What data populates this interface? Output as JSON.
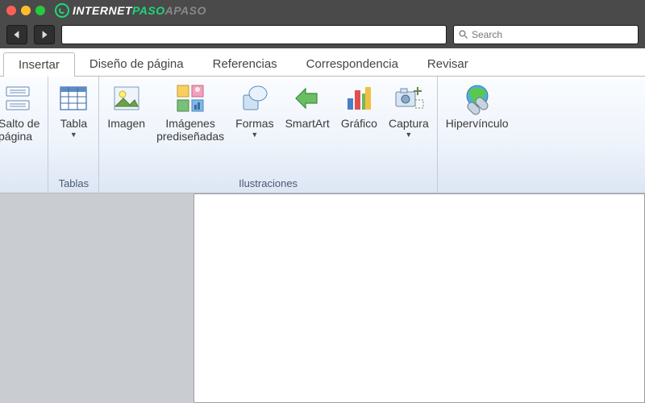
{
  "browser": {
    "logo": {
      "part1": "INTERNET",
      "part2": "PASO",
      "part3": "APASO"
    },
    "search_placeholder": "Search"
  },
  "ribbon": {
    "tabs": {
      "insertar": "Insertar",
      "diseno": "Diseño de página",
      "referencias": "Referencias",
      "correspondencia": "Correspondencia",
      "revisar": "Revisar"
    },
    "groups": {
      "paginas": {
        "salto": "Salto de\npágina"
      },
      "tablas": {
        "label": "Tablas",
        "tabla": "Tabla"
      },
      "ilustraciones": {
        "label": "Ilustraciones",
        "imagen": "Imagen",
        "predis": "Imágenes\nprediseñadas",
        "formas": "Formas",
        "smartart": "SmartArt",
        "grafico": "Gráfico",
        "captura": "Captura"
      },
      "vinculos": {
        "hiper": "Hipervínculo"
      }
    }
  }
}
